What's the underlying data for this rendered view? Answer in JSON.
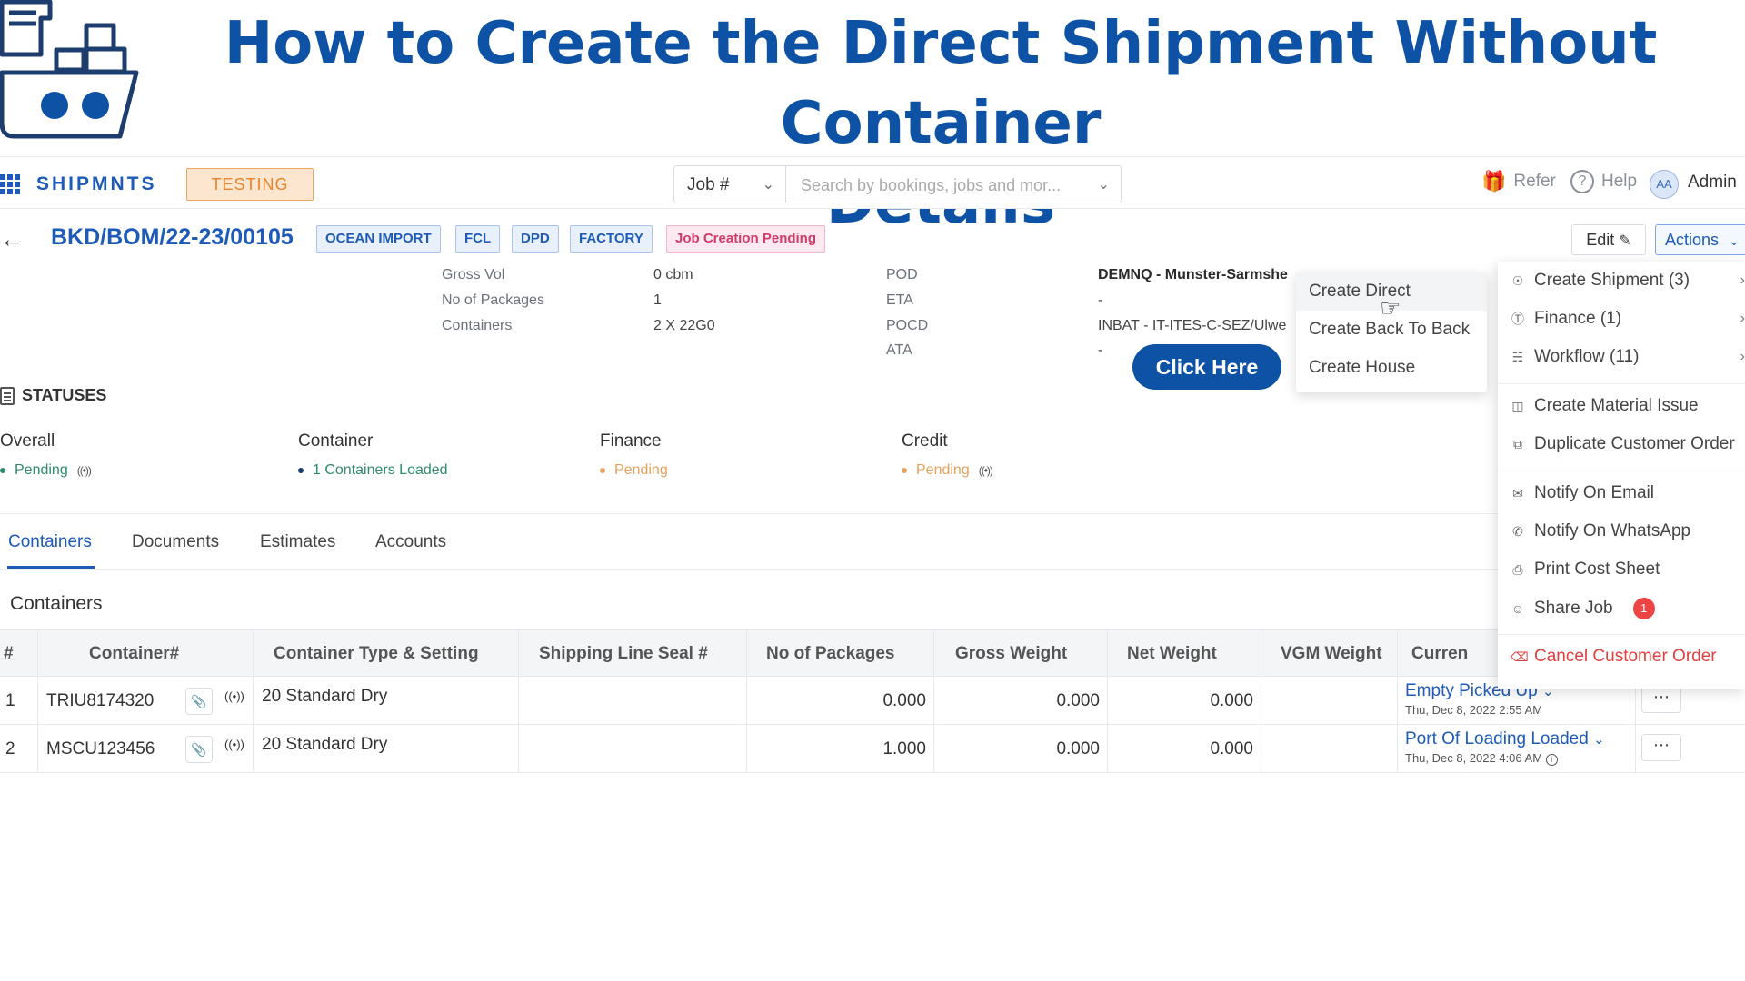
{
  "banner": {
    "title_line1": "How to Create the Direct Shipment Without Container",
    "title_line2": "Details",
    "title_color": "#0e52a6"
  },
  "nav": {
    "brand": "SHIPMNTS",
    "env_badge": "TESTING",
    "job_select": "Job #",
    "search_placeholder": "Search by bookings, jobs and mor...",
    "refer": "Refer",
    "help": "Help",
    "avatar_initials": "AA",
    "user": "Admin"
  },
  "booking": {
    "id": "BKD/BOM/22-23/00105",
    "tags": [
      "OCEAN IMPORT",
      "FCL",
      "DPD",
      "FACTORY"
    ],
    "status_tag": "Job Creation Pending",
    "edit_label": "Edit",
    "actions_label": "Actions"
  },
  "details": {
    "gross_vol_label": "Gross Vol",
    "gross_vol_value": "0 cbm",
    "packages_label": "No of Packages",
    "packages_value": "1",
    "containers_label": "Containers",
    "containers_value": "2 X 22G0",
    "pod_label": "POD",
    "pod_value": "DEMNQ - Munster-Sarmshe",
    "eta_label": "ETA",
    "eta_value": "-",
    "pocd_label": "POCD",
    "pocd_value": "INBAT - IT-ITES-C-SEZ/Ulwe",
    "ata_label": "ATA",
    "ata_value": "-"
  },
  "callout": {
    "label": "Click Here"
  },
  "create_menu": {
    "items": [
      "Create Direct",
      "Create Back To Back",
      "Create House"
    ]
  },
  "actions_menu": {
    "items": [
      {
        "label": "Create Shipment (3)",
        "icon": "compass-icon"
      },
      {
        "label": "Finance (1)",
        "icon": "dollar-icon"
      },
      {
        "label": "Workflow (11)",
        "icon": "hierarchy-icon"
      },
      {
        "label": "Create Material Issue",
        "icon": "cart-icon"
      },
      {
        "label": "Duplicate Customer Order",
        "icon": "copy-icon"
      },
      {
        "label": "Notify On Email",
        "icon": "mail-icon"
      },
      {
        "label": "Notify On WhatsApp",
        "icon": "whatsapp-icon"
      },
      {
        "label": "Print Cost Sheet",
        "icon": "printer-icon"
      },
      {
        "label": "Share Job",
        "icon": "share-user-icon",
        "badge": "1"
      },
      {
        "label": "Cancel Customer Order",
        "icon": "cancel-doc-icon",
        "color": "#e0413f"
      }
    ]
  },
  "statuses": {
    "title": "STATUSES",
    "columns": [
      {
        "title": "Overall",
        "value": "Pending",
        "color": "#2e8b6e"
      },
      {
        "title": "Container",
        "value": "1 Containers Loaded",
        "color": "#2e8b6e"
      },
      {
        "title": "Finance",
        "value": "Pending",
        "color": "#e8a15c"
      },
      {
        "title": "Credit",
        "value": "Pending",
        "color": "#e8a15c"
      }
    ]
  },
  "tabs": [
    "Containers",
    "Documents",
    "Estimates",
    "Accounts"
  ],
  "section_title": "Containers",
  "table": {
    "headers": [
      "#",
      "Container#",
      "Container Type & Setting",
      "Shipping Line Seal #",
      "No of Packages",
      "Gross Weight",
      "Net Weight",
      "VGM Weight",
      "Curren"
    ],
    "rows": [
      {
        "num": "1",
        "container": "TRIU8174320",
        "type": "20 Standard Dry",
        "seal": "",
        "packages": "0.000",
        "gross": "0.000",
        "net": "0.000",
        "vgm": "",
        "status": "Empty Picked Up",
        "status_date": "Thu, Dec 8, 2022 2:55 AM"
      },
      {
        "num": "2",
        "container": "MSCU123456",
        "type": "20 Standard Dry",
        "seal": "",
        "packages": "1.000",
        "gross": "0.000",
        "net": "0.000",
        "vgm": "",
        "status": "Port Of Loading Loaded",
        "status_date": "Thu, Dec 8, 2022 4:06 AM"
      }
    ]
  }
}
